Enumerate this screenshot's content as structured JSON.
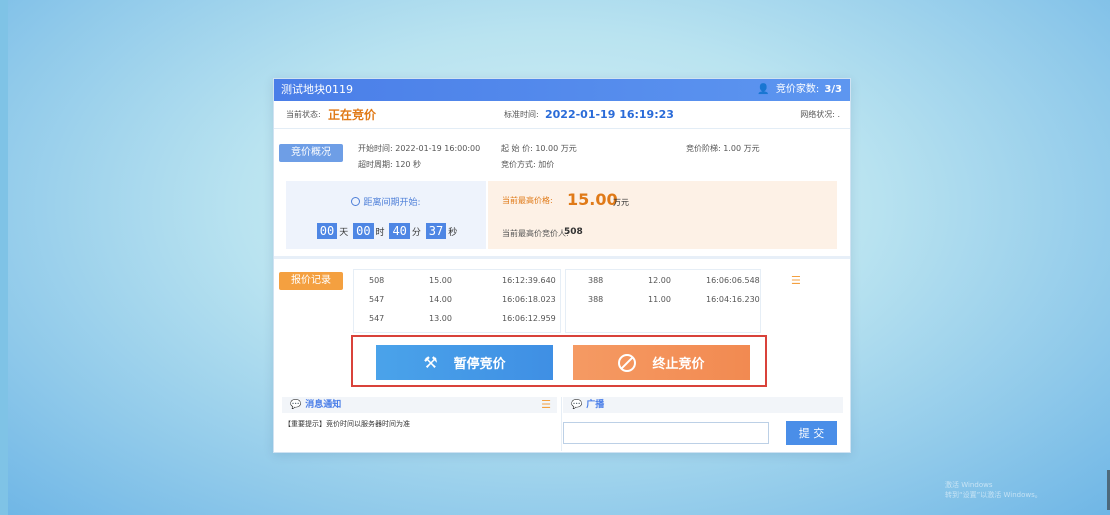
{
  "header": {
    "title": "测试地块0119",
    "bidders_label": "竞价家数:",
    "bidders_value": "3/3"
  },
  "status": {
    "label": "当前状态:",
    "value": "正在竞价",
    "std_time_label": "标准时间:",
    "std_time_value": "2022-01-19 16:19:23",
    "network_label": "网络状况:",
    "network_value": "."
  },
  "overview": {
    "tag": "竞价概况",
    "start_time": "开始时间: 2022-01-19 16:00:00",
    "timeout": "超时周期: 120 秒",
    "start_price": "起 始 价: 10.00 万元",
    "method": "竞价方式: 加价",
    "step": "竞价阶梯: 1.00 万元"
  },
  "countdown": {
    "label": "距离间期开始:",
    "days": "00",
    "days_unit": "天",
    "hours": "00",
    "hours_unit": "时",
    "minutes": "40",
    "minutes_unit": "分",
    "seconds": "37",
    "seconds_unit": "秒"
  },
  "highest": {
    "label": "当前最高价格:",
    "value": "15.00",
    "unit": "万元",
    "bidder_label": "当前最高价竞价人:",
    "bidder_value": "508"
  },
  "records": {
    "tag": "报价记录",
    "left": [
      {
        "bidder": "508",
        "price": "15.00",
        "time": "16:12:39.640"
      },
      {
        "bidder": "547",
        "price": "14.00",
        "time": "16:06:18.023"
      },
      {
        "bidder": "547",
        "price": "13.00",
        "time": "16:06:12.959"
      }
    ],
    "right": [
      {
        "bidder": "388",
        "price": "12.00",
        "time": "16:06:06.548"
      },
      {
        "bidder": "388",
        "price": "11.00",
        "time": "16:04:16.230"
      }
    ]
  },
  "actions": {
    "pause": "暂停竞价",
    "stop": "终止竞价"
  },
  "notice": {
    "title": "消息通知",
    "text": "【重要提示】竞价时间以服务器时间为准"
  },
  "broadcast": {
    "title": "广播",
    "placeholder": "",
    "submit": "提 交"
  },
  "watermark": {
    "line1": "激活 Windows",
    "line2": "转到“设置”以激活 Windows。"
  }
}
